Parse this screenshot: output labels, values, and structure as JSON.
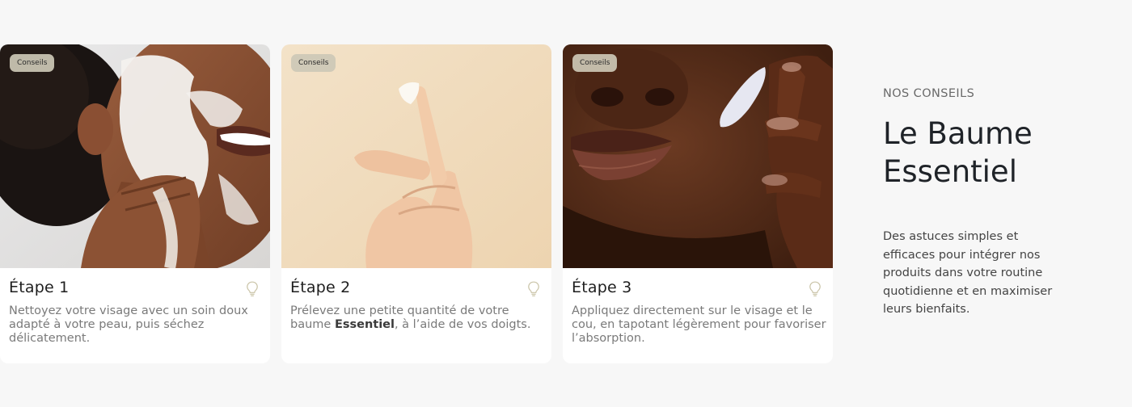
{
  "cards": [
    {
      "badge": "Conseils",
      "title": "Étape 1",
      "text": "Nettoyez votre visage avec un soin doux adapté à votre peau, puis séchez délicatement."
    },
    {
      "badge": "Conseils",
      "title": "Étape 2",
      "text_before": "Prélevez une petite quantité de votre baume ",
      "text_bold": "Essentiel",
      "text_after": ", à l’aide de vos doigts."
    },
    {
      "badge": "Conseils",
      "title": "Étape 3",
      "text": "Appliquez directement sur le visage et le cou, en tapotant légèrement pour favoriser l’absorption."
    }
  ],
  "side": {
    "eyebrow": "NOS CONSEILS",
    "heading": "Le Baume Essentiel",
    "description": "Des astuces simples et efficaces pour intégrer nos produits dans votre routine quotidienne et en maximiser leurs bienfaits."
  },
  "icons": {
    "tip": "lightbulb-icon"
  },
  "colors": {
    "page_bg": "#f7f7f7",
    "badge_bg": "#cdc8b6",
    "bulb": "#c9c3a6"
  }
}
